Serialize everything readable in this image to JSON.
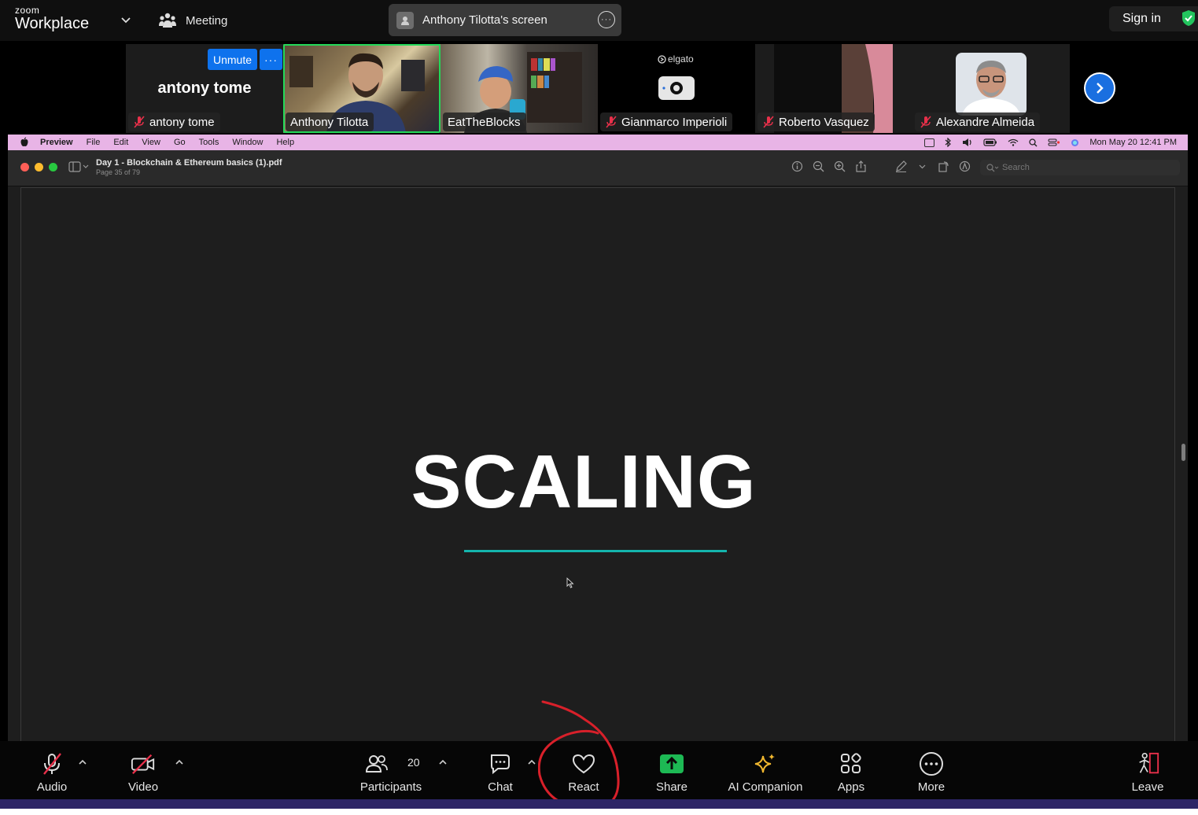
{
  "header": {
    "brand_small": "zoom",
    "brand_large": "Workplace",
    "meeting_label": "Meeting",
    "share_label": "Anthony Tilotta's screen",
    "signin_label": "Sign in"
  },
  "gallery": {
    "self": {
      "display_name": "antony tome",
      "label": "antony tome",
      "unmute_label": "Unmute",
      "more_label": "···"
    },
    "tiles": [
      {
        "name": "Anthony Tilotta",
        "muted": false,
        "active": true
      },
      {
        "name": "EatTheBlocks",
        "muted": false,
        "active": false
      },
      {
        "name": "Gianmarco Imperioli",
        "muted": true,
        "active": false,
        "overlay_text": "elgato"
      },
      {
        "name": "Roberto Vasquez",
        "muted": true,
        "active": false
      },
      {
        "name": "Alexandre Almeida",
        "muted": true,
        "active": false
      }
    ]
  },
  "mac": {
    "menu": [
      "Preview",
      "File",
      "Edit",
      "View",
      "Go",
      "Tools",
      "Window",
      "Help"
    ],
    "datetime": "Mon May 20  12:41 PM"
  },
  "preview": {
    "doc_title": "Day 1 - Blockchain & Ethereum basics (1).pdf",
    "page_info": "Page 35 of 79",
    "search_placeholder": "Search"
  },
  "slide": {
    "title": "SCALING",
    "underline_color": "#14b5ad"
  },
  "toolbar": {
    "audio": "Audio",
    "video": "Video",
    "participants": "Participants",
    "participant_count": "20",
    "chat": "Chat",
    "react": "React",
    "share": "Share",
    "ai_companion": "AI Companion",
    "apps": "Apps",
    "more": "More",
    "leave": "Leave"
  },
  "colors": {
    "accent_blue": "#0e72ed",
    "active_green": "#23d959",
    "share_green": "#1db954",
    "leave_red": "#e8304a",
    "annotation_red": "#d8202a"
  }
}
